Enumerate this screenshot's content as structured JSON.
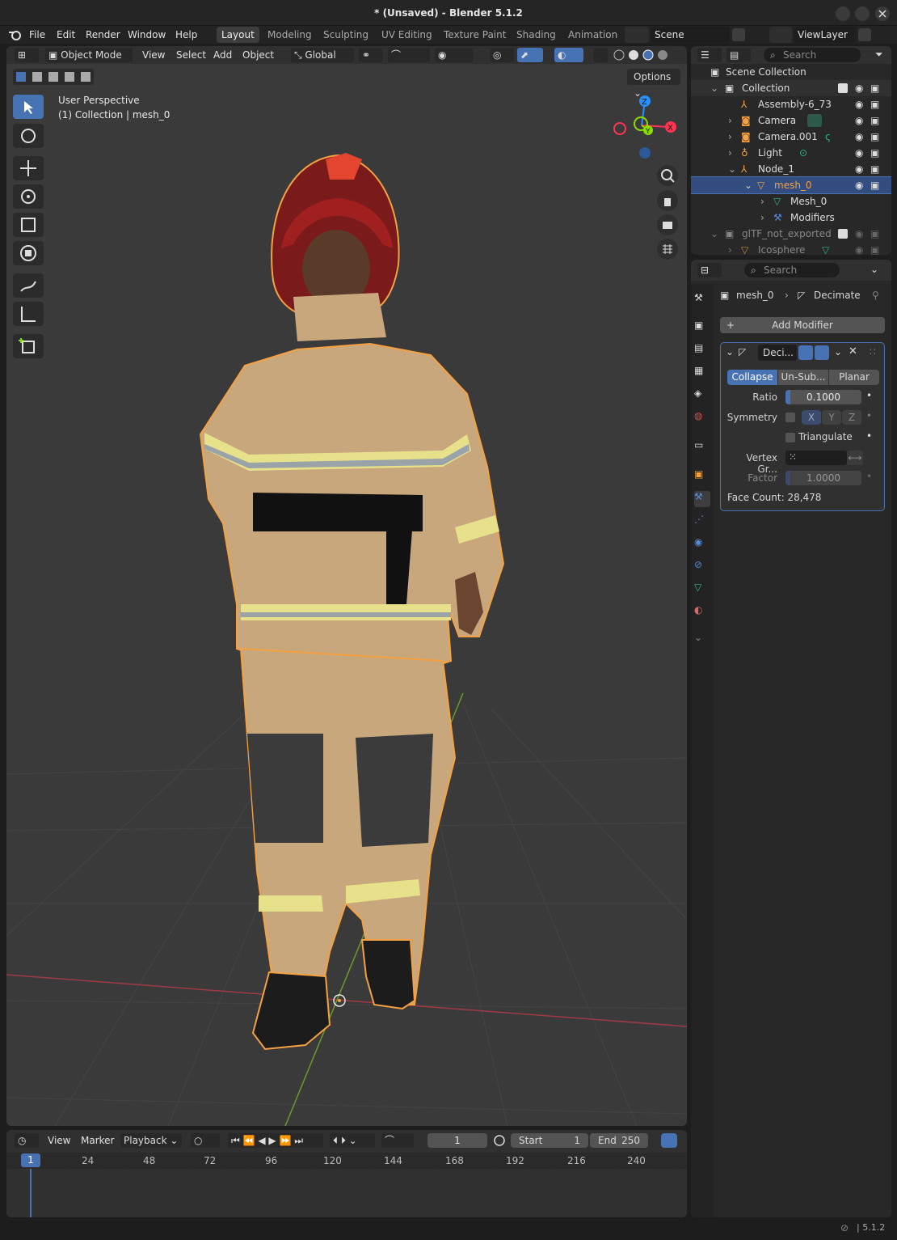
{
  "title": "* (Unsaved) - Blender 5.1.2",
  "menus": [
    "File",
    "Edit",
    "Render",
    "Window",
    "Help"
  ],
  "workspaces": [
    "Layout",
    "Modeling",
    "Sculpting",
    "UV Editing",
    "Texture Paint",
    "Shading",
    "Animation"
  ],
  "scene": "Scene",
  "view_layer": "ViewLayer",
  "viewport": {
    "mode": "Object Mode",
    "menus": [
      "View",
      "Select",
      "Add",
      "Object"
    ],
    "orientation": "Global",
    "options_label": "Options",
    "overlay_line1": "User Perspective",
    "overlay_line2": "(1) Collection | mesh_0",
    "gizmo_x": "X",
    "gizmo_y": "Y",
    "gizmo_z": "Z"
  },
  "timeline": {
    "menus": [
      "View",
      "Marker"
    ],
    "playback": "Playback",
    "current_frame": "1",
    "start_label": "Start",
    "start": "1",
    "end_label": "End",
    "end": "250",
    "ticks": [
      "1",
      "24",
      "48",
      "72",
      "96",
      "120",
      "144",
      "168",
      "192",
      "216",
      "240"
    ]
  },
  "outliner": {
    "search_placeholder": "Search",
    "scene_collection": "Scene Collection",
    "items": [
      {
        "label": "Collection"
      },
      {
        "label": "Assembly-6_73"
      },
      {
        "label": "Camera"
      },
      {
        "label": "Camera.001"
      },
      {
        "label": "Light"
      },
      {
        "label": "Node_1"
      },
      {
        "label": "mesh_0"
      },
      {
        "label": "Mesh_0"
      },
      {
        "label": "Modifiers"
      },
      {
        "label": "glTF_not_exported"
      },
      {
        "label": "Icosphere"
      }
    ]
  },
  "properties": {
    "search_placeholder": "Search",
    "breadcrumb_object": "mesh_0",
    "breadcrumb_modifier": "Decimate",
    "add_modifier": "Add Modifier",
    "modifier_name": "Deci...",
    "tabs": [
      "Collapse",
      "Un-Sub...",
      "Planar"
    ],
    "ratio_label": "Ratio",
    "ratio": "0.1000",
    "symmetry_label": "Symmetry",
    "axes": [
      "X",
      "Y",
      "Z"
    ],
    "triangulate_label": "Triangulate",
    "vertex_group_label": "Vertex Gr...",
    "factor_label": "Factor",
    "factor": "1.0000",
    "face_count": "Face Count: 28,478"
  },
  "status_version": "5.1.2",
  "colors": {
    "accent": "#4772b3",
    "selection": "#f5a142",
    "x_axis": "#ff3352",
    "y_axis": "#8bdc00",
    "z_axis": "#2890ff"
  }
}
